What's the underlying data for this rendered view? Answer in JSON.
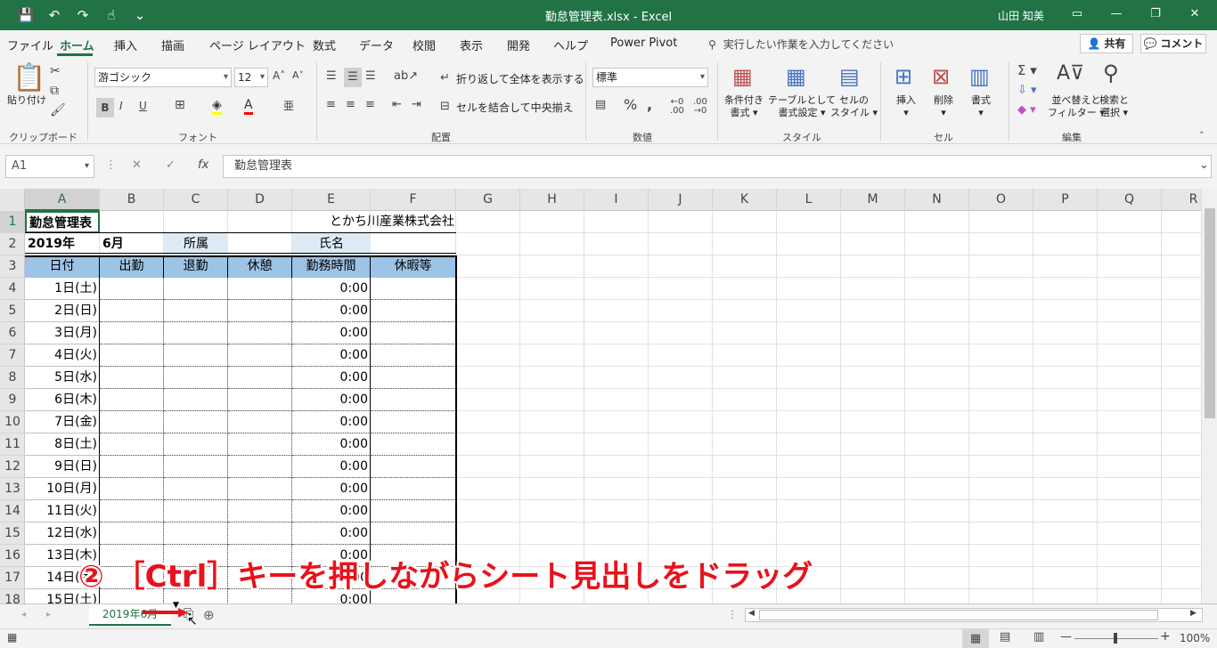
{
  "window": {
    "title": "勤怠管理表.xlsx  -  Excel",
    "user": "山田 知美"
  },
  "tabs": [
    "ファイル",
    "ホーム",
    "挿入",
    "描画",
    "ページ レイアウト",
    "数式",
    "データ",
    "校閲",
    "表示",
    "開発",
    "ヘルプ",
    "Power Pivot"
  ],
  "tellme": "実行したい作業を入力してください",
  "share_label": "共有",
  "comment_label": "コメント",
  "ribbon": {
    "paste": "貼り付け",
    "font_name": "游ゴシック",
    "font_size": "12",
    "bold": "B",
    "italic": "I",
    "underline": "U",
    "wrap_text": "折り返して全体を表示する",
    "merge_center": "セルを結合して中央揃え",
    "number_format": "標準",
    "cond_format": "条件付き",
    "cond_format2": "書式",
    "table_format": "テーブルとして",
    "table_format2": "書式設定",
    "cell_style": "セルの",
    "cell_style2": "スタイル",
    "insert": "挿入",
    "delete": "削除",
    "format": "書式",
    "sort_filter": "並べ替えと",
    "sort_filter2": "フィルター",
    "find_select": "検索と",
    "find_select2": "選択",
    "groups": {
      "clipboard": "クリップボード",
      "font": "フォント",
      "alignment": "配置",
      "number": "数値",
      "style": "スタイル",
      "cells": "セル",
      "editing": "編集"
    }
  },
  "namebox": "A1",
  "formula": "勤怠管理表",
  "columns": [
    "A",
    "B",
    "C",
    "D",
    "E",
    "F",
    "G",
    "H",
    "I",
    "J",
    "K",
    "L",
    "M",
    "N",
    "O",
    "P",
    "Q",
    "R"
  ],
  "rows": [
    "1",
    "2",
    "3",
    "4",
    "5",
    "6",
    "7",
    "8",
    "9",
    "10",
    "11",
    "12",
    "13",
    "14",
    "15",
    "16",
    "17",
    "18"
  ],
  "sheet": {
    "title": "勤怠管理表",
    "company": "とかち川産業株式会社",
    "year": "2019年",
    "month": "6月",
    "dept_label": "所属",
    "name_label": "氏名",
    "headers": [
      "日付",
      "出勤",
      "退勤",
      "休憩",
      "勤務時間",
      "休暇等"
    ],
    "dates": [
      "1日(土)",
      "2日(日)",
      "3日(月)",
      "4日(火)",
      "5日(水)",
      "6日(木)",
      "7日(金)",
      "8日(土)",
      "9日(日)",
      "10日(月)",
      "11日(火)",
      "12日(水)",
      "13日(木)",
      "14日(金)",
      "15日(土)"
    ],
    "worktime": "0:00"
  },
  "sheet_tab": "2019年6月",
  "zoom": "100%",
  "caption": "② ［Ctrl］キーを押しながらシート見出しをドラッグ"
}
